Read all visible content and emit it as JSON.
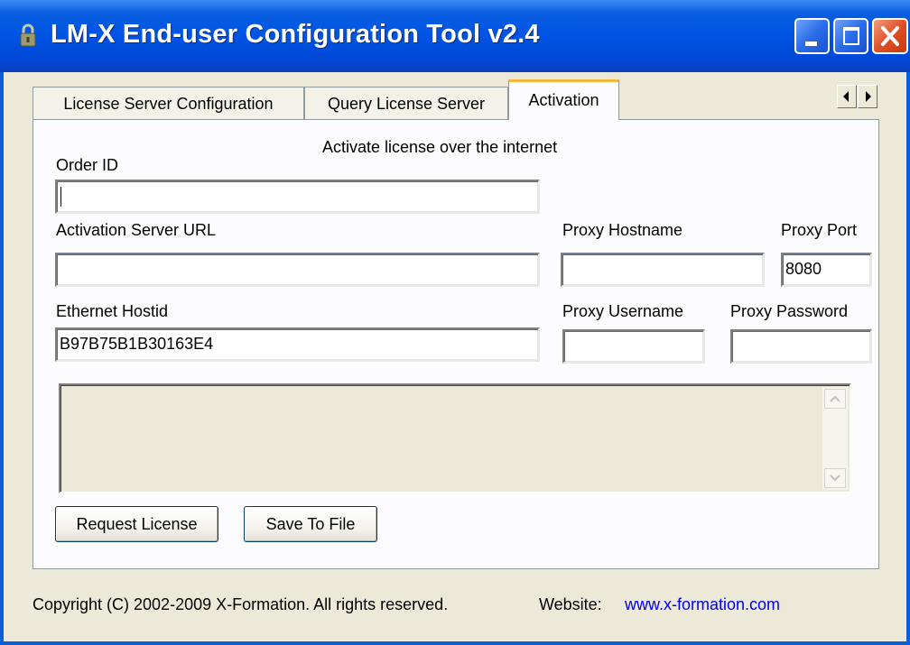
{
  "window": {
    "title": "LM-X End-user Configuration Tool v2.4"
  },
  "tabs": [
    {
      "label": "License Server Configuration"
    },
    {
      "label": "Query License Server"
    },
    {
      "label": "Activation"
    }
  ],
  "activation": {
    "heading": "Activate license over the internet",
    "order_id": {
      "label": "Order ID",
      "value": ""
    },
    "server_url": {
      "label": "Activation Server URL",
      "value": ""
    },
    "proxy_hostname": {
      "label": "Proxy Hostname",
      "value": ""
    },
    "proxy_port": {
      "label": "Proxy Port",
      "value": "8080"
    },
    "ethernet_hostid": {
      "label": "Ethernet Hostid",
      "value": "B97B75B1B30163E4"
    },
    "proxy_username": {
      "label": "Proxy Username",
      "value": ""
    },
    "proxy_password": {
      "label": "Proxy Password",
      "value": ""
    },
    "output": "",
    "request_button": "Request License",
    "save_button": "Save To File"
  },
  "footer": {
    "copyright": "Copyright (C) 2002-2009 X-Formation. All rights reserved.",
    "website_label": "Website:",
    "website_link": "www.x-formation.com"
  },
  "colors": {
    "titlebar": "#0055e5",
    "client_bg": "#ece9d8",
    "link": "#0000ee",
    "active_tab_accent": "#f5b83c"
  }
}
